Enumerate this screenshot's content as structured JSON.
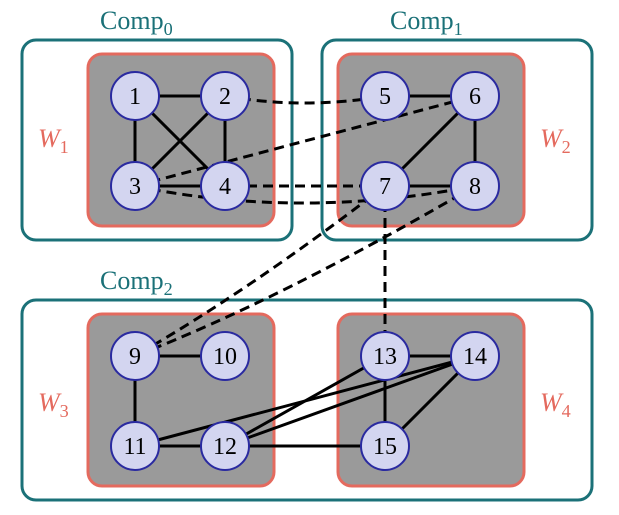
{
  "labels": {
    "comp0": "Comp",
    "comp0sub": "0",
    "comp1": "Comp",
    "comp1sub": "1",
    "comp2": "Comp",
    "comp2sub": "2",
    "w1": "W",
    "w1sub": "1",
    "w2": "W",
    "w2sub": "2",
    "w3": "W",
    "w3sub": "3",
    "w4": "W",
    "w4sub": "4"
  },
  "nodes": {
    "n1": "1",
    "n2": "2",
    "n3": "3",
    "n4": "4",
    "n5": "5",
    "n6": "6",
    "n7": "7",
    "n8": "8",
    "n9": "9",
    "n10": "10",
    "n11": "11",
    "n12": "12",
    "n13": "13",
    "n14": "14",
    "n15": "15"
  },
  "colors": {
    "teal": "#1b7178",
    "salmon": "#e46a5e",
    "gray": "#9a9a9a",
    "nodeFill": "#d3d5f0",
    "nodeStroke": "#2a2aa0",
    "edge": "#000000"
  },
  "chart_data": {
    "type": "graph",
    "nodes": [
      {
        "id": 1,
        "group": "W1",
        "comp": "Comp0"
      },
      {
        "id": 2,
        "group": "W1",
        "comp": "Comp0"
      },
      {
        "id": 3,
        "group": "W1",
        "comp": "Comp0"
      },
      {
        "id": 4,
        "group": "W1",
        "comp": "Comp0"
      },
      {
        "id": 5,
        "group": "W2",
        "comp": "Comp1"
      },
      {
        "id": 6,
        "group": "W2",
        "comp": "Comp1"
      },
      {
        "id": 7,
        "group": "W2",
        "comp": "Comp1"
      },
      {
        "id": 8,
        "group": "W2",
        "comp": "Comp1"
      },
      {
        "id": 9,
        "group": "W3",
        "comp": "Comp2"
      },
      {
        "id": 10,
        "group": "W3",
        "comp": "Comp2"
      },
      {
        "id": 11,
        "group": "W3",
        "comp": "Comp2"
      },
      {
        "id": 12,
        "group": "W3",
        "comp": "Comp2"
      },
      {
        "id": 13,
        "group": "W4",
        "comp": "Comp2"
      },
      {
        "id": 14,
        "group": "W4",
        "comp": "Comp2"
      },
      {
        "id": 15,
        "group": "W4",
        "comp": "Comp2"
      }
    ],
    "edges": [
      [
        1,
        2
      ],
      [
        1,
        3
      ],
      [
        1,
        4
      ],
      [
        2,
        3
      ],
      [
        2,
        4
      ],
      [
        3,
        4
      ],
      [
        5,
        6
      ],
      [
        6,
        7
      ],
      [
        6,
        8
      ],
      [
        7,
        8
      ],
      [
        9,
        10
      ],
      [
        9,
        11
      ],
      [
        11,
        12
      ],
      [
        13,
        14
      ],
      [
        13,
        15
      ],
      [
        14,
        15
      ],
      [
        2,
        5
      ],
      [
        3,
        6
      ],
      [
        3,
        7
      ],
      [
        3,
        8
      ],
      [
        7,
        9
      ],
      [
        7,
        13
      ],
      [
        8,
        9
      ],
      [
        12,
        13
      ],
      [
        12,
        14
      ],
      [
        11,
        14
      ],
      [
        11,
        15
      ]
    ],
    "components": [
      "Comp0",
      "Comp1",
      "Comp2"
    ],
    "groups": [
      "W1",
      "W2",
      "W3",
      "W4"
    ]
  }
}
